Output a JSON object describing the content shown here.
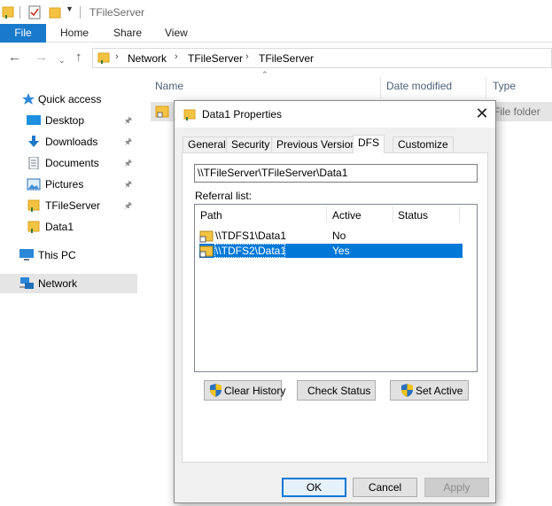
{
  "window": {
    "title": "TFileServer"
  },
  "ribbon": {
    "tabs": [
      "File",
      "Home",
      "Share",
      "View"
    ]
  },
  "address": {
    "crumbs": [
      "Network",
      "TFileServer",
      "TFileServer"
    ]
  },
  "navpane": {
    "items": [
      {
        "label": "Quick access",
        "icon": "star-icon",
        "pinned": false
      },
      {
        "label": "Desktop",
        "icon": "desktop-icon",
        "pinned": true
      },
      {
        "label": "Downloads",
        "icon": "download-icon",
        "pinned": true
      },
      {
        "label": "Documents",
        "icon": "documents-icon",
        "pinned": true
      },
      {
        "label": "Pictures",
        "icon": "pictures-icon",
        "pinned": true
      },
      {
        "label": "TFileServer",
        "icon": "folder-icon",
        "pinned": true
      },
      {
        "label": "Data1",
        "icon": "folder-icon",
        "pinned": false
      },
      {
        "label": "This PC",
        "icon": "computer-icon",
        "pinned": false
      },
      {
        "label": "Network",
        "icon": "network-icon",
        "pinned": false,
        "selected": true
      }
    ]
  },
  "filelist": {
    "columns": [
      "Name",
      "Date modified",
      "Type"
    ],
    "rows": [
      {
        "type": "File folder"
      }
    ]
  },
  "dialog": {
    "title": "Data1 Properties",
    "tabs": [
      "General",
      "Security",
      "Previous Versions",
      "DFS",
      "Customize"
    ],
    "active_tab": "DFS",
    "path_value": "\\\\TFileServer\\TFileServer\\Data1",
    "referral_label": "Referral list:",
    "list_columns": [
      "Path",
      "Active",
      "Status"
    ],
    "referrals": [
      {
        "path": "\\\\TDFS1\\Data1",
        "active": "No",
        "status": "",
        "selected": false
      },
      {
        "path": "\\\\TDFS2\\Data1",
        "active": "Yes",
        "status": "",
        "selected": true
      }
    ],
    "panel_buttons": {
      "clear_history": "Clear History",
      "check_status": "Check Status",
      "set_active": "Set Active"
    },
    "buttons": {
      "ok": "OK",
      "cancel": "Cancel",
      "apply": "Apply"
    }
  },
  "colors": {
    "accent": "#1979ca",
    "selection": "#0078d7",
    "folder": "#f5c342"
  }
}
